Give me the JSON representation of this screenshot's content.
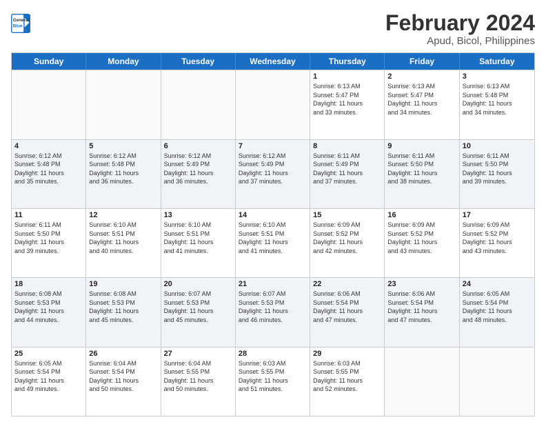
{
  "header": {
    "logo_line1": "General",
    "logo_line2": "Blue",
    "title": "February 2024",
    "subtitle": "Apud, Bicol, Philippines"
  },
  "days_of_week": [
    "Sunday",
    "Monday",
    "Tuesday",
    "Wednesday",
    "Thursday",
    "Friday",
    "Saturday"
  ],
  "weeks": [
    [
      {
        "day": "",
        "info": ""
      },
      {
        "day": "",
        "info": ""
      },
      {
        "day": "",
        "info": ""
      },
      {
        "day": "",
        "info": ""
      },
      {
        "day": "1",
        "info": "Sunrise: 6:13 AM\nSunset: 5:47 PM\nDaylight: 11 hours\nand 33 minutes."
      },
      {
        "day": "2",
        "info": "Sunrise: 6:13 AM\nSunset: 5:47 PM\nDaylight: 11 hours\nand 34 minutes."
      },
      {
        "day": "3",
        "info": "Sunrise: 6:13 AM\nSunset: 5:48 PM\nDaylight: 11 hours\nand 34 minutes."
      }
    ],
    [
      {
        "day": "4",
        "info": "Sunrise: 6:12 AM\nSunset: 5:48 PM\nDaylight: 11 hours\nand 35 minutes."
      },
      {
        "day": "5",
        "info": "Sunrise: 6:12 AM\nSunset: 5:48 PM\nDaylight: 11 hours\nand 36 minutes."
      },
      {
        "day": "6",
        "info": "Sunrise: 6:12 AM\nSunset: 5:49 PM\nDaylight: 11 hours\nand 36 minutes."
      },
      {
        "day": "7",
        "info": "Sunrise: 6:12 AM\nSunset: 5:49 PM\nDaylight: 11 hours\nand 37 minutes."
      },
      {
        "day": "8",
        "info": "Sunrise: 6:11 AM\nSunset: 5:49 PM\nDaylight: 11 hours\nand 37 minutes."
      },
      {
        "day": "9",
        "info": "Sunrise: 6:11 AM\nSunset: 5:50 PM\nDaylight: 11 hours\nand 38 minutes."
      },
      {
        "day": "10",
        "info": "Sunrise: 6:11 AM\nSunset: 5:50 PM\nDaylight: 11 hours\nand 39 minutes."
      }
    ],
    [
      {
        "day": "11",
        "info": "Sunrise: 6:11 AM\nSunset: 5:50 PM\nDaylight: 11 hours\nand 39 minutes."
      },
      {
        "day": "12",
        "info": "Sunrise: 6:10 AM\nSunset: 5:51 PM\nDaylight: 11 hours\nand 40 minutes."
      },
      {
        "day": "13",
        "info": "Sunrise: 6:10 AM\nSunset: 5:51 PM\nDaylight: 11 hours\nand 41 minutes."
      },
      {
        "day": "14",
        "info": "Sunrise: 6:10 AM\nSunset: 5:51 PM\nDaylight: 11 hours\nand 41 minutes."
      },
      {
        "day": "15",
        "info": "Sunrise: 6:09 AM\nSunset: 5:52 PM\nDaylight: 11 hours\nand 42 minutes."
      },
      {
        "day": "16",
        "info": "Sunrise: 6:09 AM\nSunset: 5:52 PM\nDaylight: 11 hours\nand 43 minutes."
      },
      {
        "day": "17",
        "info": "Sunrise: 6:09 AM\nSunset: 5:52 PM\nDaylight: 11 hours\nand 43 minutes."
      }
    ],
    [
      {
        "day": "18",
        "info": "Sunrise: 6:08 AM\nSunset: 5:53 PM\nDaylight: 11 hours\nand 44 minutes."
      },
      {
        "day": "19",
        "info": "Sunrise: 6:08 AM\nSunset: 5:53 PM\nDaylight: 11 hours\nand 45 minutes."
      },
      {
        "day": "20",
        "info": "Sunrise: 6:07 AM\nSunset: 5:53 PM\nDaylight: 11 hours\nand 45 minutes."
      },
      {
        "day": "21",
        "info": "Sunrise: 6:07 AM\nSunset: 5:53 PM\nDaylight: 11 hours\nand 46 minutes."
      },
      {
        "day": "22",
        "info": "Sunrise: 6:06 AM\nSunset: 5:54 PM\nDaylight: 11 hours\nand 47 minutes."
      },
      {
        "day": "23",
        "info": "Sunrise: 6:06 AM\nSunset: 5:54 PM\nDaylight: 11 hours\nand 47 minutes."
      },
      {
        "day": "24",
        "info": "Sunrise: 6:05 AM\nSunset: 5:54 PM\nDaylight: 11 hours\nand 48 minutes."
      }
    ],
    [
      {
        "day": "25",
        "info": "Sunrise: 6:05 AM\nSunset: 5:54 PM\nDaylight: 11 hours\nand 49 minutes."
      },
      {
        "day": "26",
        "info": "Sunrise: 6:04 AM\nSunset: 5:54 PM\nDaylight: 11 hours\nand 50 minutes."
      },
      {
        "day": "27",
        "info": "Sunrise: 6:04 AM\nSunset: 5:55 PM\nDaylight: 11 hours\nand 50 minutes."
      },
      {
        "day": "28",
        "info": "Sunrise: 6:03 AM\nSunset: 5:55 PM\nDaylight: 11 hours\nand 51 minutes."
      },
      {
        "day": "29",
        "info": "Sunrise: 6:03 AM\nSunset: 5:55 PM\nDaylight: 11 hours\nand 52 minutes."
      },
      {
        "day": "",
        "info": ""
      },
      {
        "day": "",
        "info": ""
      }
    ]
  ]
}
